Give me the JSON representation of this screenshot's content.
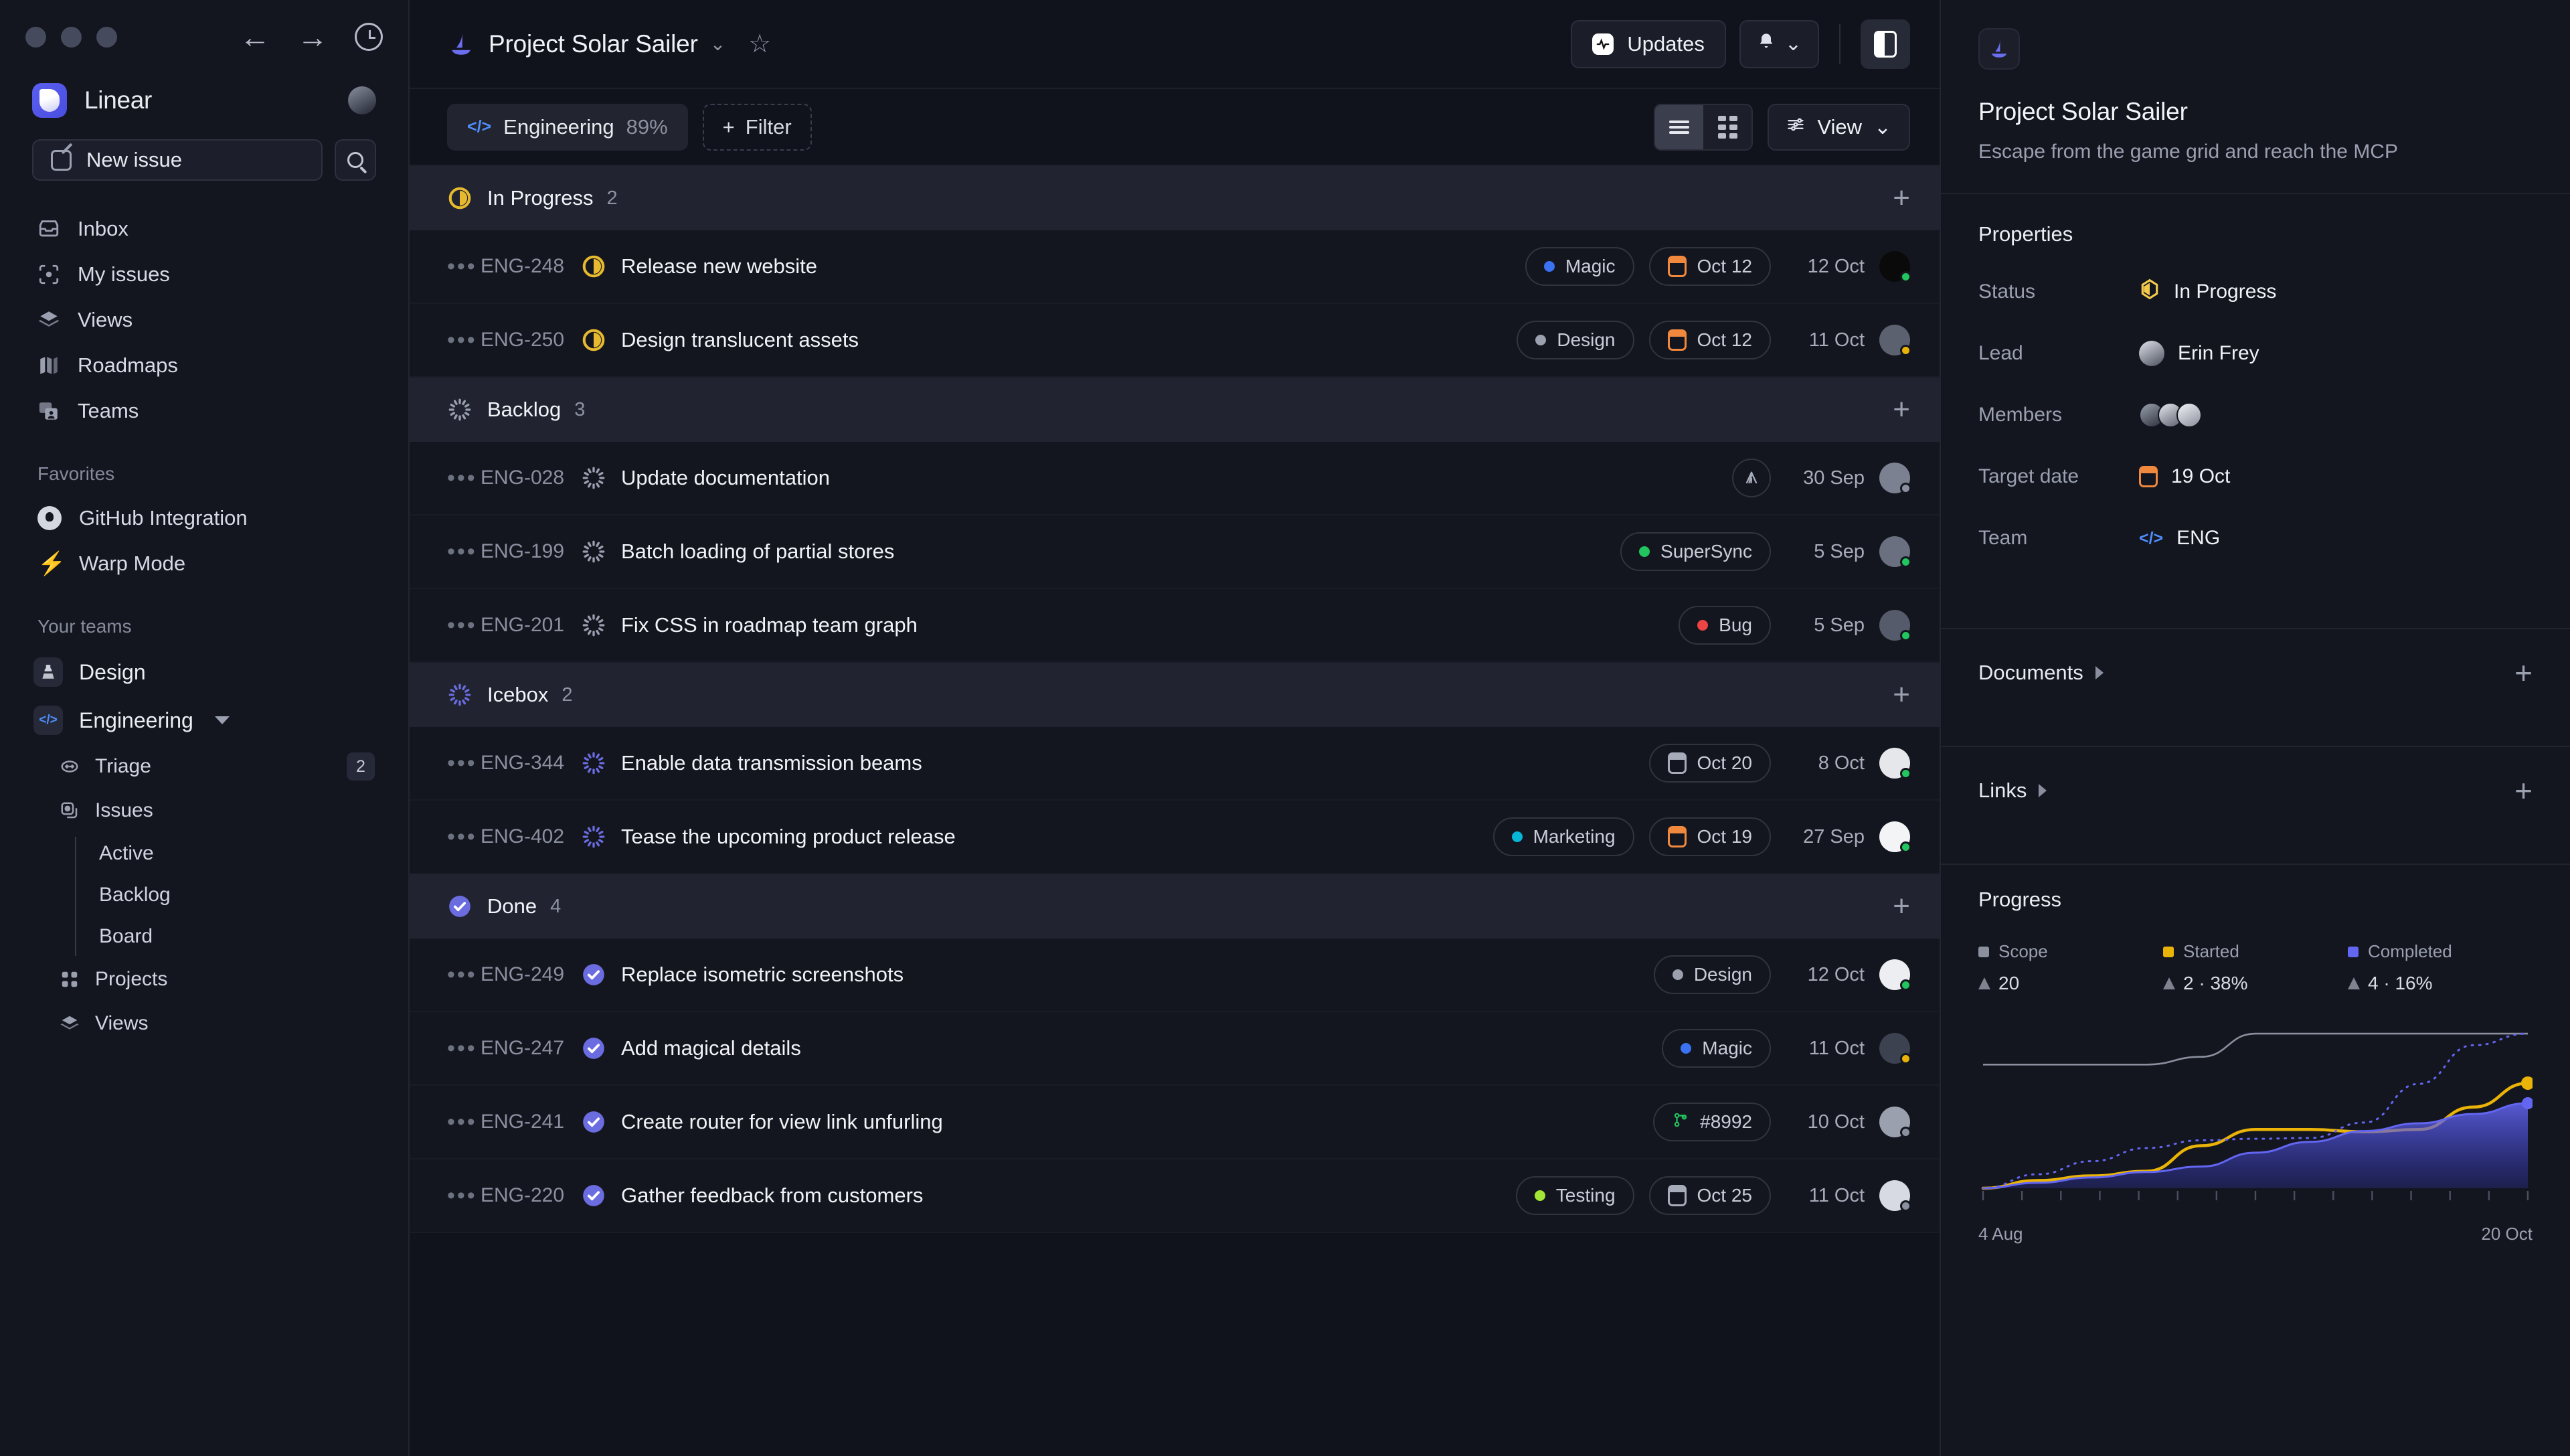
{
  "window": {
    "nav_back": "←",
    "nav_forward": "→",
    "history_icon": "clock-icon"
  },
  "sidebar": {
    "workspace": "Linear",
    "new_issue_label": "New issue",
    "search_icon": "search-icon",
    "nav_items": [
      {
        "label": "Inbox",
        "icon": "inbox-icon"
      },
      {
        "label": "My issues",
        "icon": "my-issues-icon"
      },
      {
        "label": "Views",
        "icon": "layers-icon"
      },
      {
        "label": "Roadmaps",
        "icon": "map-icon"
      },
      {
        "label": "Teams",
        "icon": "teams-icon"
      }
    ],
    "favorites_title": "Favorites",
    "favorites": [
      {
        "label": "GitHub Integration",
        "icon": "github-icon"
      },
      {
        "label": "Warp Mode",
        "icon": "bolt-icon"
      }
    ],
    "teams_title": "Your teams",
    "teams": [
      {
        "label": "Design",
        "badge_icon": "design-team-icon"
      },
      {
        "label": "Engineering",
        "badge_icon": "code-icon",
        "expanded": true
      }
    ],
    "team_children": [
      {
        "label": "Triage",
        "icon": "triage-icon",
        "count": "2"
      },
      {
        "label": "Issues",
        "icon": "issues-icon"
      }
    ],
    "issue_views": [
      "Active",
      "Backlog",
      "Board"
    ],
    "team_tail": [
      {
        "label": "Projects",
        "icon": "projects-icon"
      },
      {
        "label": "Views",
        "icon": "layers-icon"
      }
    ]
  },
  "header": {
    "project_title": "Project Solar Sailer",
    "chevron": "⌄",
    "star_icon": "star-icon",
    "updates_label": "Updates",
    "bell_icon": "bell-icon",
    "panel_toggle_icon": "right-panel-icon"
  },
  "filter_bar": {
    "team_chip_label": "Engineering",
    "team_chip_percent": "89%",
    "filter_label": "Filter",
    "view_label": "View",
    "list_view_icon": "list-icon",
    "grid_view_icon": "grid-icon"
  },
  "groups": [
    {
      "name": "In Progress",
      "count": "2",
      "state": "in-progress",
      "issues": [
        {
          "id": "ENG-248",
          "title": "Release new website",
          "state": "in-progress",
          "label": "Magic",
          "label_color": "#3b72f2",
          "due": "Oct 12",
          "due_style": "orange",
          "date": "12 Oct",
          "avatar": "#0a0a0a",
          "presence": "#22c55e"
        },
        {
          "id": "ENG-250",
          "title": "Design translucent assets",
          "state": "in-progress",
          "label": "Design",
          "label_color": "#9aa0ad",
          "due": "Oct 12",
          "due_style": "orange",
          "date": "11 Oct",
          "avatar": "#5c6170",
          "presence": "#eab308"
        }
      ]
    },
    {
      "name": "Backlog",
      "count": "3",
      "state": "backlog",
      "issues": [
        {
          "id": "ENG-028",
          "title": "Update documentation",
          "state": "backlog",
          "circle_icon": "signal-icon",
          "date": "30 Sep",
          "avatar": "#7b8191",
          "presence": "#8b909e"
        },
        {
          "id": "ENG-199",
          "title": "Batch loading of partial stores",
          "state": "backlog",
          "label": "SuperSync",
          "label_color": "#22c55e",
          "date": "5 Sep",
          "avatar": "#6a707f",
          "presence": "#22c55e"
        },
        {
          "id": "ENG-201",
          "title": "Fix CSS in roadmap team graph",
          "state": "backlog",
          "label": "Bug",
          "label_color": "#ef4444",
          "date": "5 Sep",
          "avatar": "#555b6a",
          "presence": "#22c55e"
        }
      ]
    },
    {
      "name": "Icebox",
      "count": "2",
      "state": "icebox",
      "issues": [
        {
          "id": "ENG-344",
          "title": "Enable data transmission beams",
          "state": "icebox",
          "due": "Oct 20",
          "due_style": "grey",
          "date": "8 Oct",
          "avatar": "#e5e7eb",
          "presence": "#22c55e"
        },
        {
          "id": "ENG-402",
          "title": "Tease the upcoming product release",
          "state": "icebox",
          "label": "Marketing",
          "label_color": "#06b6d4",
          "due": "Oct 19",
          "due_style": "orange",
          "date": "27 Sep",
          "avatar": "#f3f4f6",
          "presence": "#22c55e"
        }
      ]
    },
    {
      "name": "Done",
      "count": "4",
      "state": "done",
      "issues": [
        {
          "id": "ENG-249",
          "title": "Replace isometric screenshots",
          "state": "done",
          "label": "Design",
          "label_color": "#9aa0ad",
          "date": "12 Oct",
          "avatar": "#eceef2",
          "presence": "#22c55e"
        },
        {
          "id": "ENG-247",
          "title": "Add magical details",
          "state": "done",
          "label": "Magic",
          "label_color": "#3b72f2",
          "date": "11 Oct",
          "avatar": "#3d4250",
          "presence": "#eab308"
        },
        {
          "id": "ENG-241",
          "title": "Create router for view link unfurling",
          "state": "done",
          "pr": "#8992",
          "pr_color": "#22c55e",
          "date": "10 Oct",
          "avatar": "#9aa0ae",
          "presence": "#8b909e"
        },
        {
          "id": "ENG-220",
          "title": "Gather feedback from customers",
          "state": "done",
          "label": "Testing",
          "label_color": "#a3e635",
          "due": "Oct 25",
          "due_style": "grey",
          "date": "11 Oct",
          "avatar": "#d7dae2",
          "presence": "#8b909e"
        }
      ]
    }
  ],
  "right_panel": {
    "project_icon": "sailboat-icon",
    "title": "Project Solar Sailer",
    "description": "Escape from the game grid and reach the MCP",
    "properties_title": "Properties",
    "properties": [
      {
        "label": "Status",
        "value": "In Progress",
        "icon": "in-progress-icon"
      },
      {
        "label": "Lead",
        "value": "Erin Frey",
        "icon": "avatar-icon"
      },
      {
        "label": "Members",
        "value": "",
        "icon": "member-avatars"
      },
      {
        "label": "Target date",
        "value": "19 Oct",
        "icon": "calendar-orange-icon"
      },
      {
        "label": "Team",
        "value": "ENG",
        "icon": "code-icon"
      }
    ],
    "documents_title": "Documents",
    "links_title": "Links",
    "add_icon": "plus-icon",
    "progress_title": "Progress"
  },
  "chart_data": {
    "type": "line",
    "title": "Progress",
    "xlabel": "",
    "ylabel": "",
    "x_tick_labels": [
      "4 Aug",
      "20 Oct"
    ],
    "x_axis_start": "4 Aug",
    "x_axis_end": "20 Oct",
    "grid": false,
    "legend": [
      {
        "name": "Scope",
        "color": "#8b909e",
        "delta": "20"
      },
      {
        "name": "Started",
        "color": "#eab308",
        "delta": "2 · 38%"
      },
      {
        "name": "Completed",
        "color": "#6366f1",
        "delta": "4 · 16%"
      }
    ],
    "legend_position": "top",
    "x": [
      0,
      10,
      20,
      30,
      40,
      50,
      60,
      70,
      80,
      90,
      100
    ],
    "series": [
      {
        "name": "Scope",
        "color": "#8b909e",
        "style": "solid",
        "values": [
          16,
          16,
          16,
          16,
          17,
          20,
          20,
          20,
          20,
          20,
          20
        ]
      },
      {
        "name": "Started",
        "color": "#eab308",
        "style": "solid",
        "values": [
          0,
          1,
          1.6,
          2.2,
          5.5,
          7.6,
          7.6,
          7.3,
          7.6,
          10.5,
          13.6
        ]
      },
      {
        "name": "Completed",
        "color": "#6366f1",
        "style": "solid-area",
        "values": [
          0,
          0.7,
          1.4,
          2.1,
          2.8,
          4.6,
          6.0,
          7.4,
          8.4,
          9.6,
          11.0
        ]
      },
      {
        "name": "Projection",
        "color": "#6366f1",
        "style": "dotted",
        "values": [
          0,
          1.8,
          3.5,
          5.2,
          6.2,
          6.4,
          6.5,
          8.5,
          13.5,
          18.5,
          20
        ]
      }
    ],
    "ylim": [
      0,
      22
    ]
  }
}
